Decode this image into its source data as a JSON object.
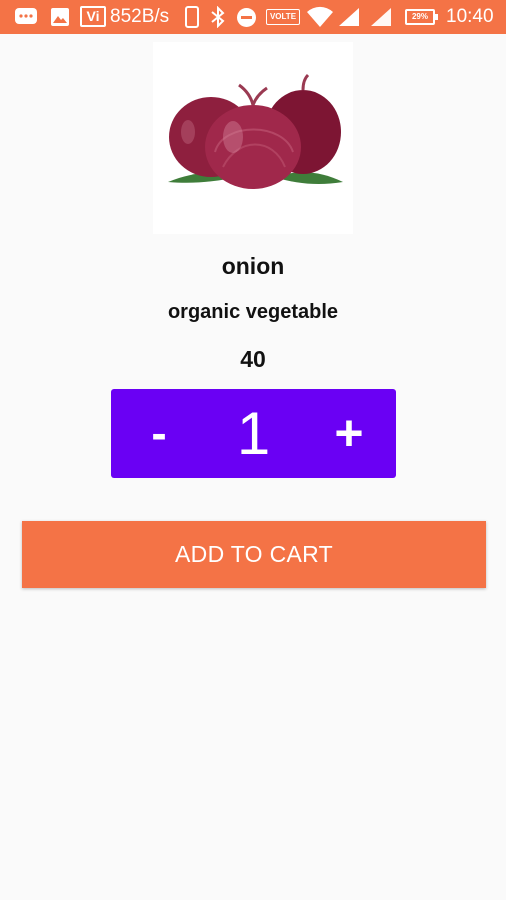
{
  "status_bar": {
    "carrier_badge": "Vi",
    "network_speed": "852B/s",
    "volte_label": "VOLTE",
    "battery_percent": "29%",
    "time": "10:40",
    "icons": [
      "message-icon",
      "image-icon",
      "phone-icon",
      "bluetooth-icon",
      "dnd-icon",
      "wifi-icon",
      "signal-icon",
      "signal-icon",
      "battery-icon"
    ]
  },
  "product": {
    "image_icon": "onion-image",
    "name": "onion",
    "category": "organic vegetable",
    "price": "40"
  },
  "quantity": {
    "decrement_label": "-",
    "value": "1",
    "increment_label": "+"
  },
  "cart": {
    "button_label": "ADD TO CART"
  },
  "colors": {
    "accent": "#f47346",
    "stepper": "#6a00f4",
    "background": "#fafafa"
  }
}
